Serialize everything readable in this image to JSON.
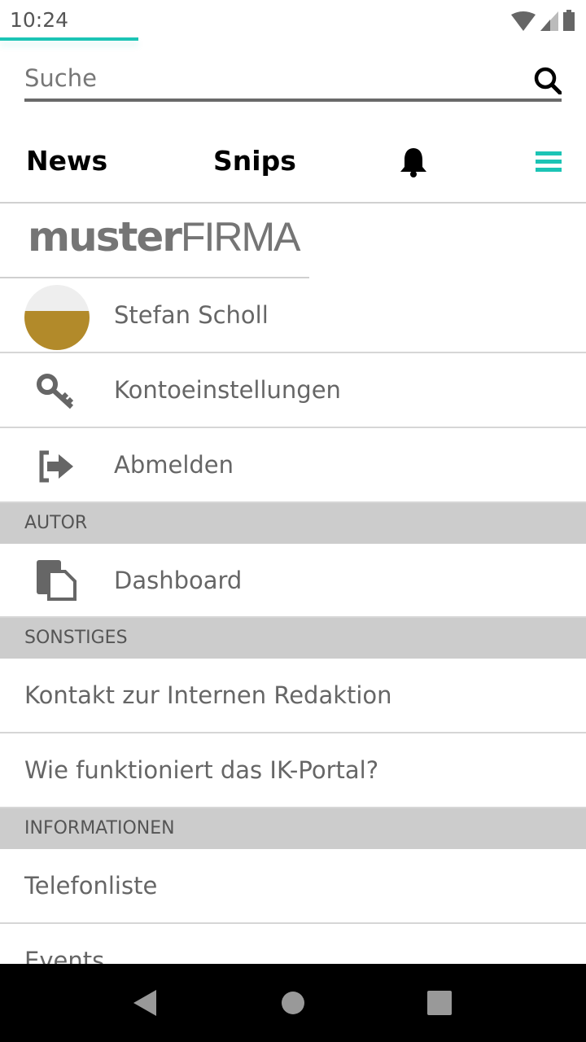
{
  "status_bar": {
    "time": "10:24"
  },
  "search": {
    "placeholder": "Suche",
    "value": ""
  },
  "nav": {
    "news": "News",
    "snips": "Snips"
  },
  "logo": {
    "bold": "muster",
    "light": "FIRMA"
  },
  "menu": {
    "user": "Stefan Scholl",
    "account": "Kontoeinstellungen",
    "logout": "Abmelden",
    "section_author": "AUTOR",
    "dashboard": "Dashboard",
    "section_misc": "SONSTIGES",
    "contact": "Kontakt zur Internen Redaktion",
    "howto": "Wie funktioniert das IK-Portal?",
    "section_info": "INFORMATIONEN",
    "phone": "Telefonliste",
    "events": "Events"
  },
  "colors": {
    "accent": "#1cc4b5",
    "section_bg": "#cccccc",
    "text": "#666666"
  }
}
